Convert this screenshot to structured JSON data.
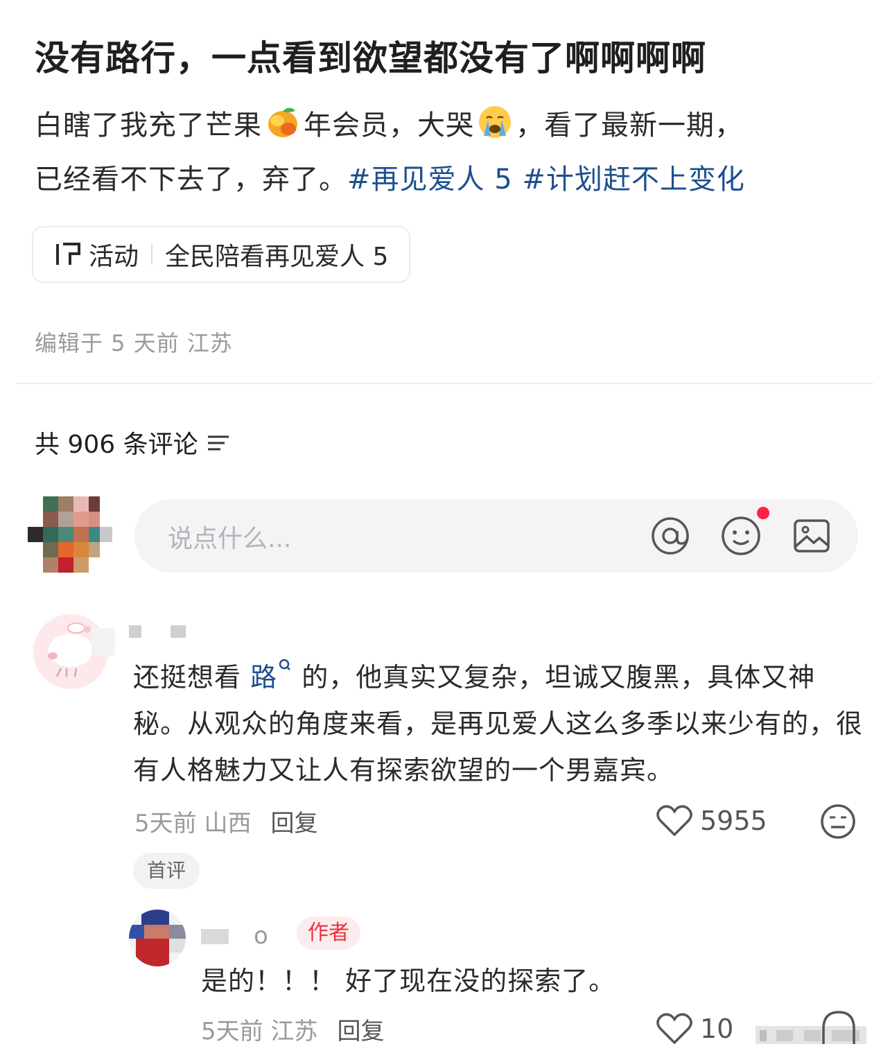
{
  "post": {
    "title": "没有路行，一点看到欲望都没有了啊啊啊啊",
    "body_part1": "白瞎了我充了芒果",
    "body_part2": "年会员，大哭",
    "body_part3": "，看了最新一期，",
    "body_part4": "已经看不下去了，弃了。",
    "tag1": "#再见爱人 5",
    "tag2": "#计划赶不上变化",
    "emoji1": "mango-emoji",
    "emoji2": "crying-face-emoji"
  },
  "activity": {
    "icon": "activity-icon",
    "label": "活动",
    "name": "全民陪看再见爱人 5"
  },
  "edit_meta": "编辑于 5 天前 江苏",
  "comments_header": {
    "label": "共 906 条评论",
    "icon": "sort-icon"
  },
  "comment_input": {
    "placeholder": "说点什么...",
    "icons": [
      "at-icon",
      "emoji-icon",
      "image-icon"
    ]
  },
  "comment1": {
    "text_before": "还挺想看 ",
    "mention": "路",
    "text_after": " 的，他真实又复杂，坦诚又腹黑，具体又神秘。从观众的角度来看，是再见爱人这么多季以来少有的，很有人格魅力又让人有探索欲望的一个男嘉宾。",
    "time_location": "5天前 山西",
    "reply_label": "回复",
    "likes": "5955",
    "badge": "首评"
  },
  "reply1": {
    "author_badge": "作者",
    "name_fragment": "o",
    "text": "是的！！！ 好了现在没的探索了。",
    "time_location": "5天前 江苏",
    "reply_label": "回复",
    "likes": "10"
  },
  "colors": {
    "tag": "#1d4f8f",
    "author_red": "#e8343e",
    "notify_dot": "#ff2442",
    "meta_gray": "#9a9a9a"
  }
}
